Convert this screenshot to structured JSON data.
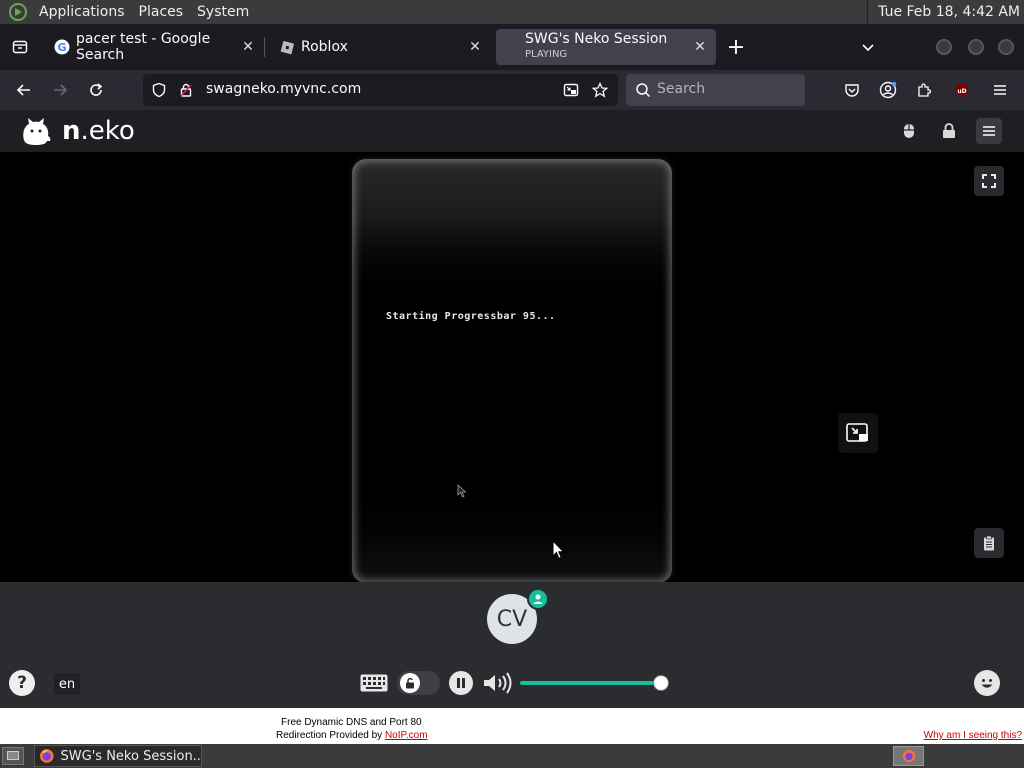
{
  "panel": {
    "menus": [
      "Applications",
      "Places",
      "System"
    ],
    "clock": "Tue Feb 18,  4:42 AM"
  },
  "tabs": [
    {
      "title": "pacer test - Google Search",
      "favicon": "google-icon"
    },
    {
      "title": "Roblox",
      "favicon": "roblox-icon"
    },
    {
      "title": "SWG's Neko Session",
      "subtitle": "PLAYING",
      "active": true
    }
  ],
  "nav": {
    "url": "swagneko.myvnc.com",
    "search_placeholder": "Search"
  },
  "neko": {
    "logo_bold": "n",
    "logo_rest": ".eko",
    "video_text": "Starting Progressbar 95...",
    "avatar_initials": "CV",
    "language": "en",
    "volume": 0.95,
    "accent": "#19bd9c"
  },
  "banner": {
    "line1": "Free Dynamic DNS and Port 80",
    "line2_prefix": "Redirection Provided by ",
    "line2_link": "NoIP.com",
    "why": "Why am I seeing this?"
  },
  "taskbar": {
    "window_title": "SWG's Neko Session..."
  }
}
